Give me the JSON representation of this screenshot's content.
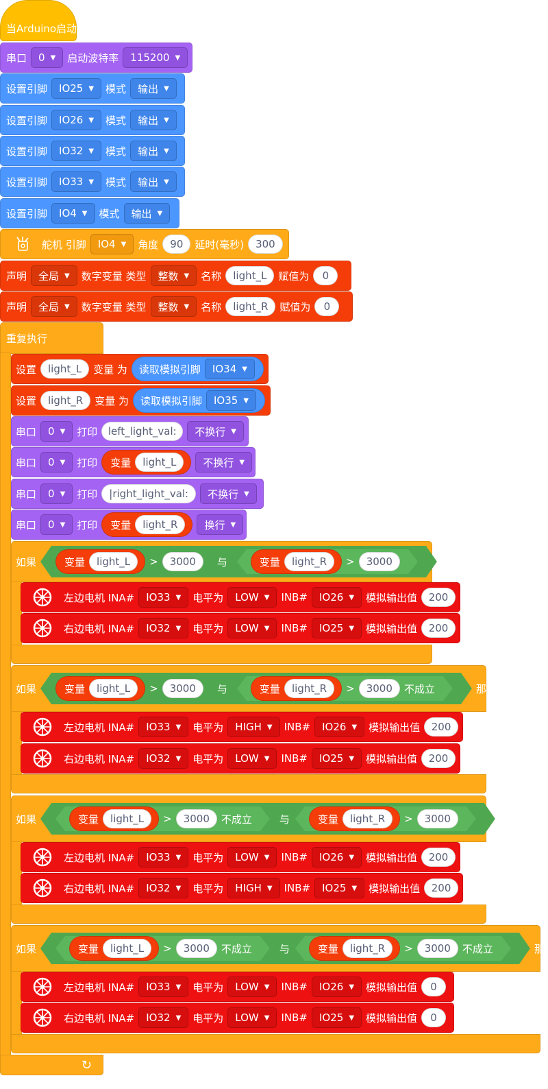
{
  "labels": {
    "when_start": "当Arduino启动",
    "serial": "串口",
    "baud": "启动波特率",
    "set_pin": "设置引脚",
    "mode": "模式",
    "servo": "舵机 引脚",
    "angle": "角度",
    "delay": "延时(毫秒)",
    "declare": "声明",
    "numvar_type": "数字变量 类型",
    "name": "名称",
    "assign": "赋值为",
    "repeat": "重复执行",
    "set": "设置",
    "var_to": "变量 为",
    "read_analog": "读取模拟引脚",
    "print": "打印",
    "variable": "变量",
    "if": "如果",
    "then": "那么",
    "and": "与",
    "not": "不成立",
    "left_motor": "左边电机 INA#",
    "right_motor": "右边电机 INA#",
    "level": "电平为",
    "inb": "INB#",
    "analog_out": "模拟输出值",
    "gt": ">",
    "serial_cut": "串口",
    "loop_arrow": "↻"
  },
  "values": {
    "serial_port": "0",
    "baud_rate": "115200",
    "output": "输出",
    "global": "全局",
    "integer": "整数",
    "no_newline": "不换行",
    "newline": "换行",
    "servo_angle": "90",
    "servo_delay": "300",
    "init_zero": "0",
    "threshold": "3000",
    "speed": "200",
    "stop_speed": "0",
    "str_left": "left_light_val:",
    "str_right": "|right_light_val:"
  },
  "pins": {
    "p25": "IO25",
    "p26": "IO26",
    "p32": "IO32",
    "p33": "IO33",
    "p4": "IO4",
    "p34": "IO34",
    "p35": "IO35"
  },
  "vars": {
    "left": "light_L",
    "right": "light_R"
  },
  "levels": {
    "low": "LOW",
    "high": "HIGH"
  },
  "colors": {
    "event": "#FFBF00",
    "control": "#FFAB19",
    "serial": "#A463F2",
    "io": "#4C97FF",
    "variable": "#F43D09",
    "motor": "#EE1111",
    "logic": "#5CB65C"
  },
  "icons": {
    "servo": "servo-icon",
    "wheel": "wheel-icon",
    "dropdown": "chevron-down-icon",
    "repeat": "loop-arrow-icon"
  }
}
